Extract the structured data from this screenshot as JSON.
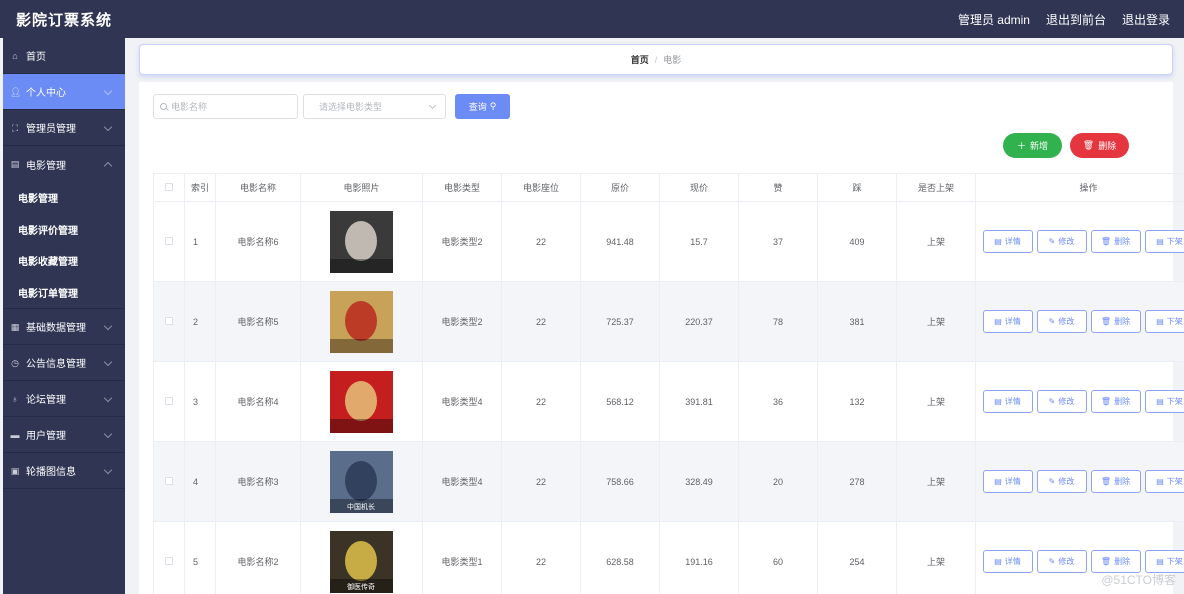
{
  "app": {
    "title": "影院订票系统"
  },
  "header": {
    "user": "管理员 admin",
    "to_front": "退出到前台",
    "logout": "退出登录"
  },
  "sidebar": {
    "items": [
      {
        "label": "首页",
        "icon": "home-icon"
      },
      {
        "label": "个人中心",
        "icon": "user-icon"
      },
      {
        "label": "管理员管理",
        "icon": "frame-icon"
      },
      {
        "label": "电影管理",
        "icon": "film-icon"
      },
      {
        "label": "基础数据管理",
        "icon": "grid-icon"
      },
      {
        "label": "公告信息管理",
        "icon": "clock-icon"
      },
      {
        "label": "论坛管理",
        "icon": "mic-icon"
      },
      {
        "label": "用户管理",
        "icon": "card-icon"
      },
      {
        "label": "轮播图信息",
        "icon": "gift-icon"
      }
    ],
    "movie_sub": [
      "电影管理",
      "电影评价管理",
      "电影收藏管理",
      "电影订单管理"
    ]
  },
  "breadcrumb": {
    "home": "首页",
    "sep": "/",
    "current": "电影"
  },
  "search": {
    "name_placeholder": "电影名称",
    "type_placeholder": "请选择电影类型",
    "query_label": "查询"
  },
  "toolbar": {
    "add_label": "新增",
    "delete_label": "删除"
  },
  "table": {
    "headers": [
      "索引",
      "电影名称",
      "电影照片",
      "电影类型",
      "电影座位",
      "原价",
      "现价",
      "赞",
      "踩",
      "是否上架",
      "操作"
    ],
    "actions": {
      "detail": "详情",
      "edit": "修改",
      "delete": "删除",
      "offshelf": "下架"
    },
    "rows": [
      {
        "index": "1",
        "name": "电影名称6",
        "type": "电影类型2",
        "seats": "22",
        "orig": "941.48",
        "now": "15.7",
        "likes": "37",
        "dislikes": "409",
        "status": "上架"
      },
      {
        "index": "2",
        "name": "电影名称5",
        "type": "电影类型2",
        "seats": "22",
        "orig": "725.37",
        "now": "220.37",
        "likes": "78",
        "dislikes": "381",
        "status": "上架"
      },
      {
        "index": "3",
        "name": "电影名称4",
        "type": "电影类型4",
        "seats": "22",
        "orig": "568.12",
        "now": "391.81",
        "likes": "36",
        "dislikes": "132",
        "status": "上架"
      },
      {
        "index": "4",
        "name": "电影名称3",
        "type": "电影类型4",
        "seats": "22",
        "orig": "758.66",
        "now": "328.49",
        "likes": "20",
        "dislikes": "278",
        "status": "上架"
      },
      {
        "index": "5",
        "name": "电影名称2",
        "type": "电影类型1",
        "seats": "22",
        "orig": "628.58",
        "now": "191.16",
        "likes": "60",
        "dislikes": "254",
        "status": "上架"
      }
    ]
  },
  "posters": [
    {
      "bg": "#3a3a3a",
      "accent": "#d8d0c8",
      "caption": ""
    },
    {
      "bg": "#c9a25a",
      "accent": "#b8291f",
      "caption": ""
    },
    {
      "bg": "#c41e1e",
      "accent": "#e8c27a",
      "caption": ""
    },
    {
      "bg": "#5a6e8c",
      "accent": "#2b3a55",
      "caption": "中国机长"
    },
    {
      "bg": "#3b3426",
      "accent": "#e0c14a",
      "caption": "御医传奇"
    }
  ],
  "watermark": "@51CTO博客",
  "colors": {
    "header_bg": "#2f3553",
    "accent": "#6c8cf5",
    "add_btn": "#32b24e",
    "delete_btn": "#e5353e"
  }
}
